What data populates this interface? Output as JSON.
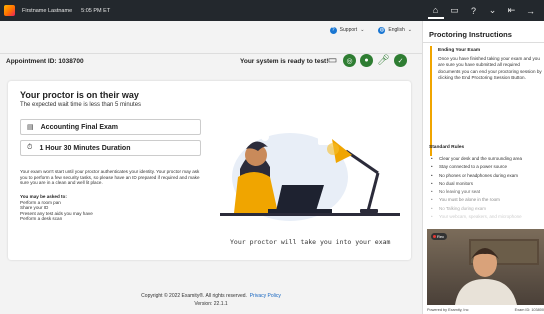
{
  "topbar": {
    "user_name": "Firstname Lastname",
    "time": "5:05 PM ET"
  },
  "subbar": {
    "support_label": "Support",
    "language_label": "English"
  },
  "header": {
    "appointment": "Appointment ID: 1038700",
    "system_ready": "Your system is ready to test!",
    "system_checks": [
      "monitor-icon",
      "chrome-icon",
      "webcam-icon",
      "microphone-icon",
      "network-icon"
    ]
  },
  "card": {
    "title": "Your proctor is on their way",
    "subtitle": "The expected wait time is less than 5 minutes",
    "exam_name": "Accounting Final Exam",
    "duration": "1 Hour 30 Minutes Duration",
    "description": "Your exam won't start until your proctor authenticates your identity. Your proctor may ask you to perform a few security tasks, so please have an ID prepared if required and make sure you are in a clean and well lit place.",
    "ask_title": "You may be asked to:",
    "steps": [
      "Perform a room pan",
      "Share your ID",
      "Present any test aids you may have",
      "Perform a desk scan"
    ],
    "illustration_caption": "Your proctor will take you into your exam"
  },
  "footer": {
    "copyright": "Copyright © 2022 Examity®. All rights reserved.",
    "privacy_link": "Privacy Policy",
    "version": "Version: 22.1.1"
  },
  "panel": {
    "title": "Proctoring Instructions",
    "ending_title": "Ending Your Exam",
    "ending_text": "Once you have finished taking your exam and you are sure you have submitted all required documents you can end your proctoring session by clicking the End Proctoring Session Button.",
    "rules_title": "Standard Rules",
    "rules": [
      "Clear your desk and the surrounding area",
      "Stay connected to a power source",
      "No phones or headphones during exam",
      "No dual monitors",
      "No leaving your seat",
      "You must be alone in the room",
      "No Talking during exam",
      "Your webcam, speakers, and microphone"
    ],
    "video_badge": "Rec",
    "powered_by": "Powered by Examity, Inc",
    "exam_id": "Exam ID: 103800"
  },
  "colors": {
    "topbar": "#23282d",
    "accent_orange": "#f0a500",
    "check_green": "#2e7d32",
    "link_blue": "#1565c0"
  }
}
